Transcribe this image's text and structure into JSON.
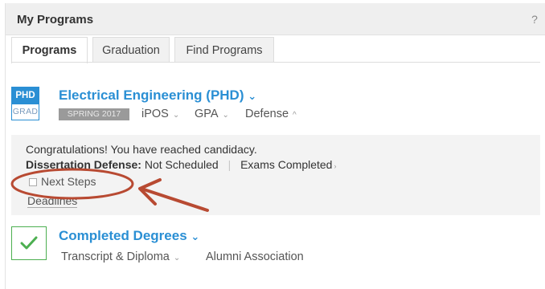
{
  "panel": {
    "title": "My Programs",
    "help_icon": "?"
  },
  "tabs": [
    {
      "label": "Programs",
      "active": true
    },
    {
      "label": "Graduation",
      "active": false
    },
    {
      "label": "Find Programs",
      "active": false
    }
  ],
  "program": {
    "badge_top": "PHD",
    "badge_bottom": "GRAD",
    "title": "Electrical Engineering (PHD)",
    "chevron": "⌄",
    "term": "SPRING 2017",
    "links": [
      {
        "label": "iPOS",
        "chevron": "⌄"
      },
      {
        "label": "GPA",
        "chevron": "⌄"
      },
      {
        "label": "Defense",
        "chevron": "^"
      }
    ]
  },
  "info": {
    "congrats": "Congratulations! You have reached candidacy.",
    "defense_label": "Dissertation Defense:",
    "defense_value": "Not Scheduled",
    "sep": "|",
    "exams": "Exams Completed",
    "exams_chev": "›",
    "next_steps": "Next Steps",
    "deadlines": "Deadlines"
  },
  "completed": {
    "title": "Completed Degrees",
    "chevron": "⌄",
    "transcript": "Transcript & Diploma",
    "transcript_chev": "⌄",
    "alumni": "Alumni Association"
  },
  "colors": {
    "accent": "#2a8fd4",
    "success": "#4caf50",
    "annotation": "#b84a32"
  },
  "icons": [
    "help-icon",
    "chevron-down-icon",
    "checkbox-icon",
    "checkmark-icon",
    "annotation-arrow"
  ]
}
